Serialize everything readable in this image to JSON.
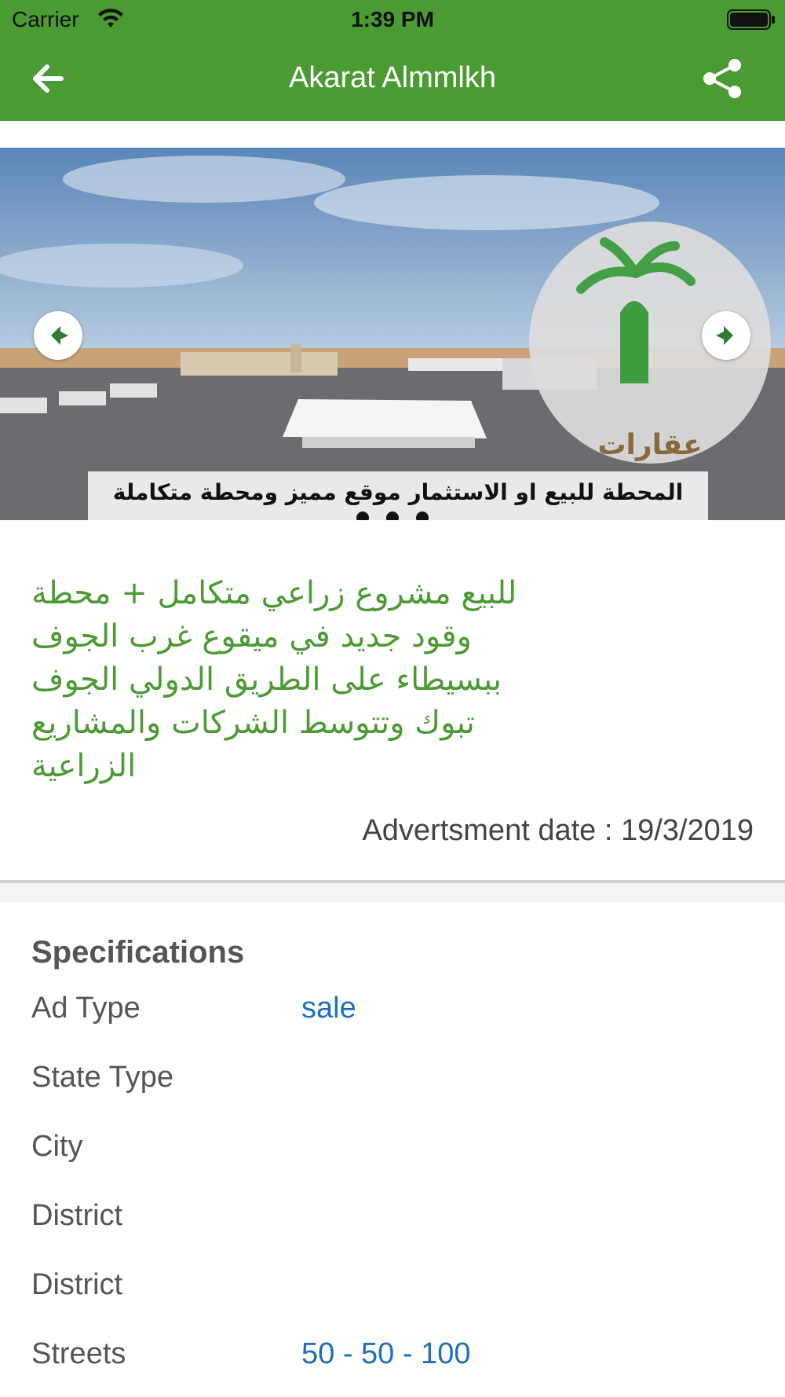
{
  "status_bar": {
    "carrier": "Carrier",
    "time": "1:39 PM"
  },
  "nav": {
    "title": "Akarat Almmlkh"
  },
  "carousel": {
    "caption": "المحطة للبيع او الاستثمار موقع مميز ومحطة متكاملة",
    "logo_text": "عقارات المملكة",
    "dots": 3
  },
  "listing": {
    "description_lines": [
      "للبيع مشروع زراعي متكامل + محطة",
      "وقود جديد في ميقوع غرب الجوف",
      "ببسيطاء على الطريق الدولي الجوف",
      "تبوك وتتوسط الشركات والمشاريع",
      "الزراعية"
    ],
    "ad_date": "Advertsment date : 19/3/2019"
  },
  "specifications": {
    "title": "Specifications",
    "rows": [
      {
        "label": "Ad Type",
        "value": "sale"
      },
      {
        "label": "State Type",
        "value": ""
      },
      {
        "label": "City",
        "value": ""
      },
      {
        "label": "District",
        "value": ""
      },
      {
        "label": "District",
        "value": ""
      },
      {
        "label": "Streets",
        "value": "50 - 50 - 100"
      }
    ]
  },
  "colors": {
    "brand_green": "#4b9b33",
    "link_blue": "#1f6fbf"
  },
  "icons": {
    "back": "arrow-left-icon",
    "share": "share-icon",
    "prev": "prev-arrow-icon",
    "next": "next-arrow-icon"
  }
}
